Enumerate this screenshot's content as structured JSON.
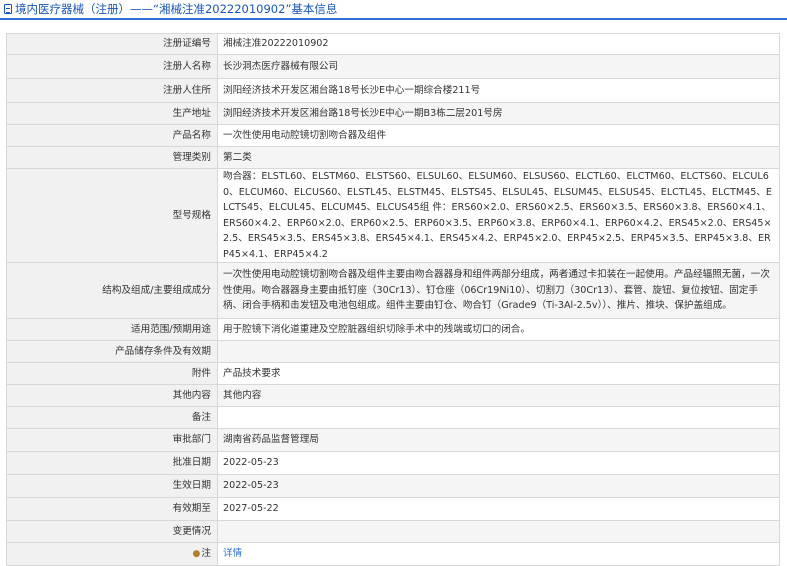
{
  "header": {
    "title": "境内医疗器械（注册）——“湘械注准20222010902”基本信息"
  },
  "rows": [
    {
      "label": "注册证编号",
      "value": "湘械注准20222010902"
    },
    {
      "label": "注册人名称",
      "value": "长沙洞杰医疗器械有限公司"
    },
    {
      "label": "注册人住所",
      "value": "浏阳经济技术开发区湘台路18号长沙E中心一期综合楼211号"
    },
    {
      "label": "生产地址",
      "value": "浏阳经济技术开发区湘台路18号长沙E中心一期B3栋二层201号房"
    },
    {
      "label": "产品名称",
      "value": "一次性使用电动腔镜切割吻合器及组件"
    },
    {
      "label": "管理类别",
      "value": "第二类"
    },
    {
      "label": "型号规格",
      "value": "吻合器：ELSTL60、ELSTM60、ELSTS60、ELSUL60、ELSUM60、ELSUS60、ELCTL60、ELCTM60、ELCTS60、ELCUL60、ELCUM60、ELCUS60、ELSTL45、ELSTM45、ELSTS45、ELSUL45、ELSUM45、ELSUS45、ELCTL45、ELCTM45、ELCTS45、ELCUL45、ELCUM45、ELCUS45组 件：ERS60×2.0、ERS60×2.5、ERS60×3.5、ERS60×3.8、ERS60×4.1、ERS60×4.2、ERP60×2.0、ERP60×2.5、ERP60×3.5、ERP60×3.8、ERP60×4.1、ERP60×4.2、ERS45×2.0、ERS45×2.5、ERS45×3.5、ERS45×3.8、ERS45×4.1、ERS45×4.2、ERP45×2.0、ERP45×2.5、ERP45×3.5、ERP45×3.8、ERP45×4.1、ERP45×4.2"
    },
    {
      "label": "结构及组成/主要组成成分",
      "value": "一次性使用电动腔镜切割吻合器及组件主要由吻合器器身和组件两部分组成，两者通过卡扣装在一起使用。产品经辐照无菌，一次性使用。吻合器器身主要由抵钉座（30Cr13）、钉仓座（06Cr19Ni10）、切割刀（30Cr13）、套管、旋钮、复位按钮、固定手柄、闭合手柄和击发钮及电池包组成。组件主要由钉仓、吻合钉（Grade9（Ti-3Al-2.5v））、推片、推块、保护盖组成。"
    },
    {
      "label": "适用范围/预期用途",
      "value": "用于腔镜下消化道重建及空腔脏器组织切除手术中的残端或切口的闭合。"
    },
    {
      "label": "产品储存条件及有效期",
      "value": ""
    },
    {
      "label": "附件",
      "value": "产品技术要求"
    },
    {
      "label": "其他内容",
      "value": "其他内容"
    },
    {
      "label": "备注",
      "value": ""
    },
    {
      "label": "审批部门",
      "value": "湖南省药品监督管理局"
    },
    {
      "label": "批准日期",
      "value": "2022-05-23"
    },
    {
      "label": "生效日期",
      "value": "2022-05-23"
    },
    {
      "label": "有效期至",
      "value": "2027-05-22"
    },
    {
      "label": "变更情况",
      "value": ""
    },
    {
      "label": "注",
      "value": "详情"
    }
  ]
}
